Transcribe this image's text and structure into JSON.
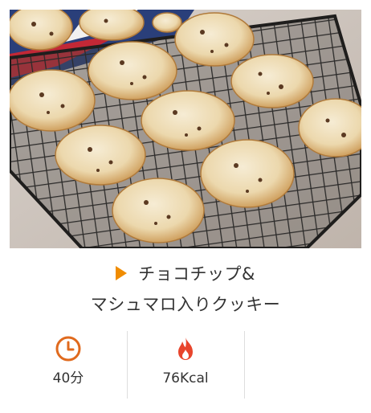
{
  "recipe": {
    "image_alt": "cookies-on-cooling-rack",
    "title_lines": [
      "チョコチップ&",
      "マシュマロ入りクッキー"
    ],
    "accent_color": "#f08c00",
    "fire_color": "#e8452c"
  },
  "stats": [
    {
      "icon": "clock-icon",
      "value": "40分"
    },
    {
      "icon": "fire-icon",
      "value": "76Kcal"
    }
  ]
}
